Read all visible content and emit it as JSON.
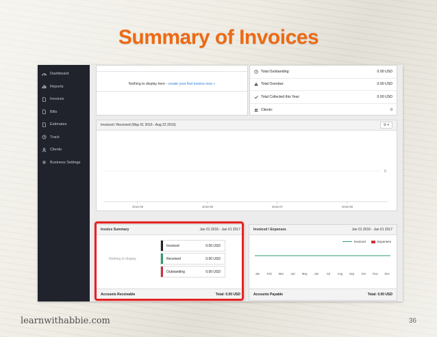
{
  "slide": {
    "title": "Summary of Invoices",
    "footer_site": "learnwithabbie.com",
    "page_number": "36"
  },
  "sidebar": {
    "items": [
      {
        "label": "Dashboard",
        "icon": "dashboard-icon"
      },
      {
        "label": "Reports",
        "icon": "bar-chart-icon"
      },
      {
        "label": "Invoices",
        "icon": "document-icon"
      },
      {
        "label": "Bills",
        "icon": "document-icon"
      },
      {
        "label": "Estimates",
        "icon": "document-icon"
      },
      {
        "label": "Track",
        "icon": "clock-icon"
      },
      {
        "label": "Clients",
        "icon": "user-icon"
      },
      {
        "label": "Business Settings",
        "icon": "gear-icon"
      }
    ]
  },
  "nothing_panel": {
    "message_prefix": "Nothing to display here - ",
    "message_link": "create your first invoice now »"
  },
  "stats": [
    {
      "label": "Total Outstanding:",
      "value": "0.00 USD",
      "icon": "clock-icon"
    },
    {
      "label": "Total Overdue:",
      "value": "0.00 USD",
      "icon": "warning-icon"
    },
    {
      "label": "Total Collected this Year:",
      "value": "0.00 USD",
      "icon": "check-icon"
    },
    {
      "label": "Clients:",
      "value": "0",
      "icon": "users-icon"
    }
  ],
  "chart": {
    "title": "Invoiced / Received (May 01 2016 - Aug 22 2016)",
    "gear": "⚙ ▾",
    "end_label": "0",
    "x_ticks": [
      "2016-05",
      "2016-06",
      "2016-07",
      "2016-08"
    ]
  },
  "summary": {
    "title": "Invoice Summary",
    "range": "Jan 01 2016 - Jan 01 2017",
    "nothing": "Nothing to display",
    "rows": [
      {
        "label": "Invoiced",
        "value": "0.00 USD",
        "color": "#222222"
      },
      {
        "label": "Received",
        "value": "0.00 USD",
        "color": "#2a9d6b"
      },
      {
        "label": "Outstanding",
        "value": "0.00 USD",
        "color": "#d0303c"
      }
    ],
    "footer_label": "Accounts Receivable",
    "footer_total": "Total: 0.00 USD"
  },
  "expenses": {
    "title": "Invoiced / Expenses",
    "range": "Jan 01 2016 - Jan 01 2017",
    "legend_invoiced": "Invoiced",
    "legend_expenses": "Expenses",
    "months": [
      "Jan",
      "Feb",
      "Mar",
      "Apr",
      "May",
      "Jun",
      "Jul",
      "Aug",
      "Sep",
      "Oct",
      "Nov",
      "Dec"
    ],
    "footer_label": "Accounts Payable",
    "footer_total": "Total: 0.00 USD"
  },
  "colors": {
    "title_orange": "#ee6a13",
    "highlight_red": "#e32323",
    "sidebar_bg": "#20232b"
  }
}
